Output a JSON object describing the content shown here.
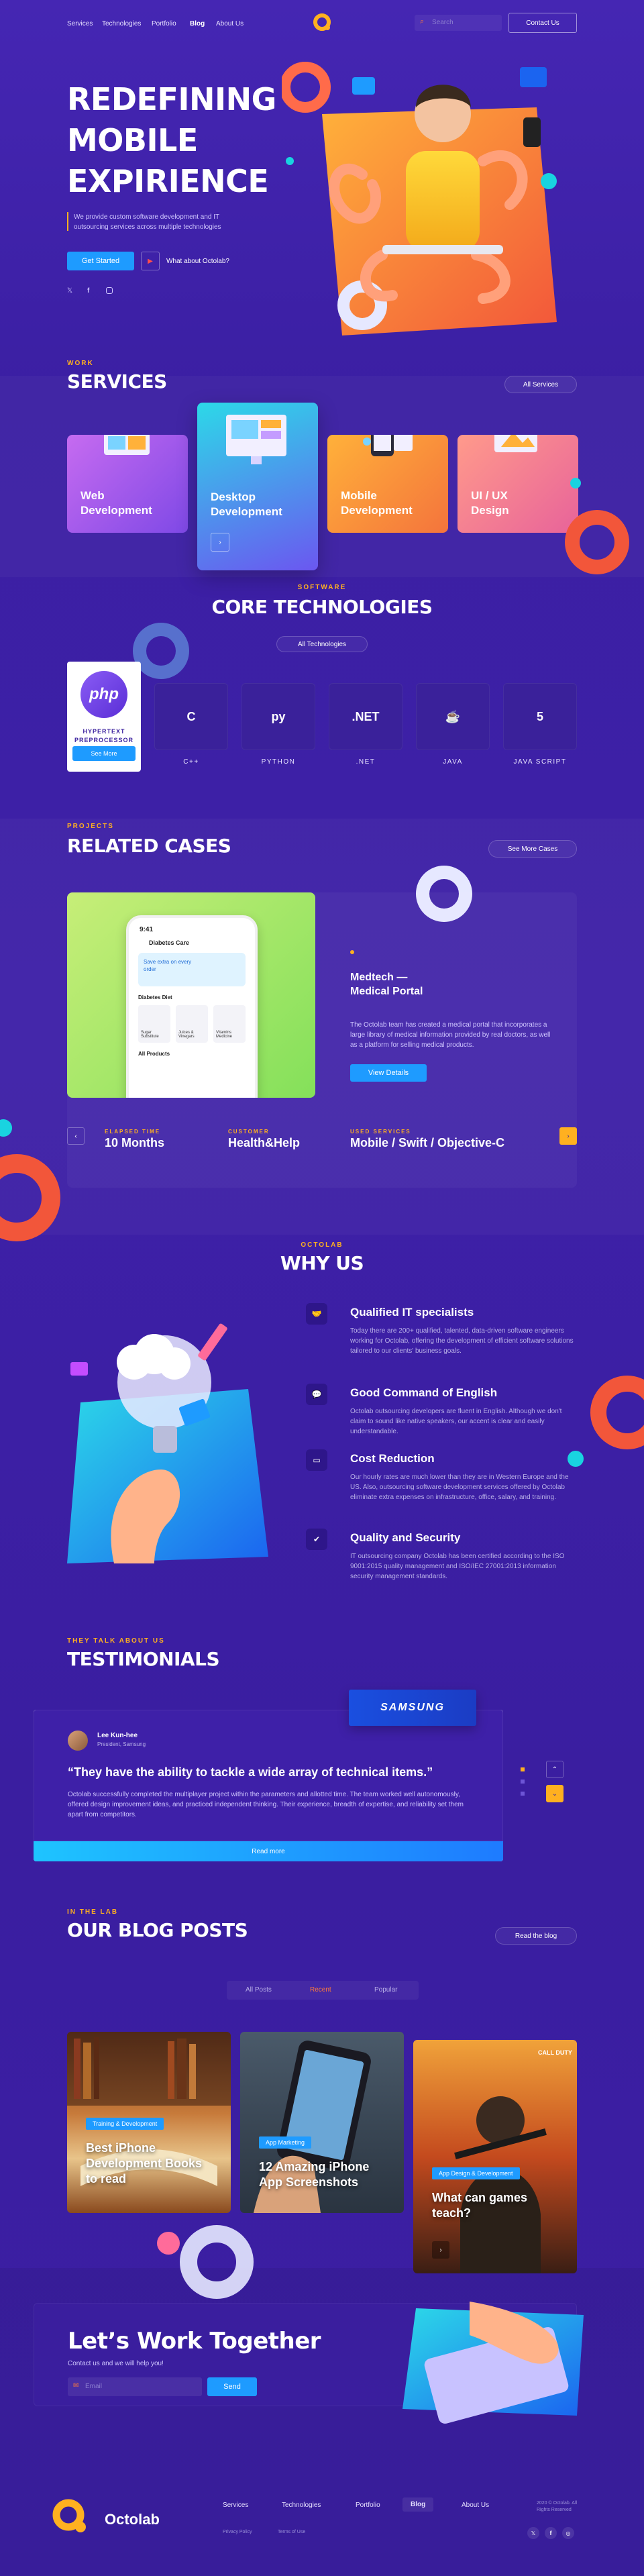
{
  "nav": {
    "items": [
      "Services",
      "Technologies",
      "Portfolio",
      "Blog",
      "About Us"
    ],
    "active": "Blog",
    "search_placeholder": "Search",
    "contact_label": "Contact Us"
  },
  "hero": {
    "title_line1": "REDEFINING",
    "title_line2": "MOBILE",
    "title_line3": "EXPIRIENCE",
    "description": "We provide custom software development and IT outsourcing services across multiple technologies",
    "cta_label": "Get Started",
    "video_label": "What about Octolab?",
    "social": [
      "twitter-icon",
      "facebook-icon",
      "instagram-icon"
    ]
  },
  "services": {
    "eyebrow": "WORK",
    "title": "SERVICES",
    "all_label": "All Services",
    "items": [
      {
        "title_line1": "Web",
        "title_line2": "Development",
        "color1": "#c66bf0",
        "color2": "#7f49e6"
      },
      {
        "title_line1": "Desktop",
        "title_line2": "Development",
        "color1": "#2cd9e8",
        "color2": "#6b57f0"
      },
      {
        "title_line1": "Mobile",
        "title_line2": "Development",
        "color1": "#ffb13a",
        "color2": "#f4743c"
      },
      {
        "title_line1": "UI / UX",
        "title_line2": "Design",
        "color1": "#ff9a8b",
        "color2": "#e8639a"
      }
    ]
  },
  "technologies": {
    "eyebrow": "SOFTWARE",
    "title": "CORE TECHNOLOGIES",
    "all_label": "All Technologies",
    "featured": {
      "name": "php",
      "caption_line1": "HYPERTEXT",
      "caption_line2": "PREPROCESSOR",
      "more_label": "See More"
    },
    "items": [
      {
        "icon": "cplusplus-icon",
        "label": "C++",
        "glyph": "C"
      },
      {
        "icon": "python-icon",
        "label": "PYTHON",
        "glyph": "py"
      },
      {
        "icon": "dotnet-icon",
        "label": ".NET",
        "glyph": ".NET"
      },
      {
        "icon": "java-icon",
        "label": "JAVA",
        "glyph": "☕"
      },
      {
        "icon": "javascript-icon",
        "label": "JAVA SCRIPT",
        "glyph": "5"
      }
    ]
  },
  "cases": {
    "eyebrow": "PROJECTS",
    "title": "RELATED CASES",
    "more_label": "See More Cases",
    "phone": {
      "time": "9:41",
      "app_title": "Diabetes Care",
      "banner": "Save extra on every order",
      "section": "Diabetes Diet",
      "products_label": "All Products",
      "products": [
        "Sugar Substitute",
        "Juices & Vinegars",
        "Vitamins Medicine"
      ]
    },
    "case_title_line1": "Medtech —",
    "case_title_line2": "Medical Portal",
    "case_text": "The Octolab team has created a medical portal that incorporates a large library of medical information provided by real doctors, as well as a platform for selling medical products.",
    "view_label": "View Details",
    "stats": [
      {
        "label": "ELAPSED TIME",
        "value": "10 Months"
      },
      {
        "label": "CUSTOMER",
        "value": "Health&Help"
      },
      {
        "label": "USED SERVICES",
        "value": "Mobile / Swift / Objective-C"
      }
    ]
  },
  "why": {
    "eyebrow": "OCTOLAB",
    "title": "WHY US",
    "items": [
      {
        "icon": "handshake-icon",
        "title": "Qualified IT specialists",
        "text": "Today there are 200+ qualified, talented, data-driven software engineers working for Octolab, offering the development of efficient software solutions tailored to our clients' business goals."
      },
      {
        "icon": "chat-icon",
        "title": "Good Command of English",
        "text": "Octolab outsourcing developers are fluent in English. Although we don't claim to sound like native speakers, our accent is clear and easily understandable."
      },
      {
        "icon": "money-icon",
        "title": "Cost Reduction",
        "text": "Our hourly rates are much lower than they are in Western Europe and the US. Also, outsourcing software development services offered by Octolab eliminate extra expenses on infrastructure, office, salary, and training."
      },
      {
        "icon": "shield-check-icon",
        "title": "Quality and Security",
        "text": "IT outsourcing company Octolab has been certified according to the ISO 9001:2015 quality management and ISO/IEC 27001:2013 information security management standards."
      }
    ]
  },
  "testimonials": {
    "eyebrow": "THEY TALK ABOUT US",
    "title": "TESTIMONIALS",
    "brand": "SAMSUNG",
    "author_name": "Lee Kun-hee",
    "author_role": "President, Samsung",
    "quote": "“They have the ability to tackle a wide array of technical items.”",
    "text": "Octolab successfully completed the multiplayer project within the parameters and allotted time. The team worked well autonomously, offered design improvement ideas, and practiced independent thinking. Their experience, breadth of expertise, and reliability set them apart from competitors.",
    "read_more": "Read more"
  },
  "blog": {
    "eyebrow": "IN THE LAB",
    "title": "OUR BLOG POSTS",
    "read_label": "Read the blog",
    "tabs": [
      "All Posts",
      "Recent",
      "Popular"
    ],
    "active_tab": "Recent",
    "posts": [
      {
        "tag": "Training & Development",
        "title_line1": "Best iPhone",
        "title_line2": "Development Books",
        "title_line3": "to read"
      },
      {
        "tag": "App Marketing",
        "title_line1": "12 Amazing iPhone",
        "title_line2": "App Screenshots",
        "title_line3": ""
      },
      {
        "tag": "App Design & Development",
        "title_line1": "What can games",
        "title_line2": "teach?",
        "title_line3": "",
        "game_title": "CALL DUTY"
      }
    ]
  },
  "cta": {
    "title": "Let’s Work Together",
    "subtitle": "Contact us and we will help you!",
    "email_placeholder": "Email",
    "send_label": "Send"
  },
  "footer": {
    "brand": "Octolab",
    "links": [
      "Services",
      "Technologies",
      "Portfolio",
      "Blog",
      "About Us"
    ],
    "active": "Blog",
    "policy": "Privacy Policy",
    "terms": "Terms of Use",
    "copyright": "2020 © Octolab. All Rights Reserved",
    "social": [
      "twitter-icon",
      "facebook-icon",
      "instagram-icon"
    ]
  }
}
